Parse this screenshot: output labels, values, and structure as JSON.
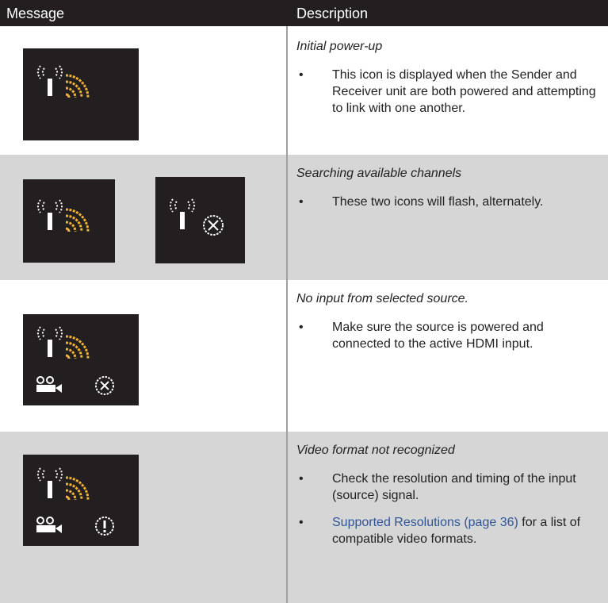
{
  "header": {
    "col1": "Message",
    "col2": "Description"
  },
  "rows": [
    {
      "title": "Initial power-up",
      "bullets": [
        {
          "text": "This icon is displayed when the Sender and Receiver unit are both powered and attempting to link with one another."
        }
      ]
    },
    {
      "title": "Searching available channels",
      "bullets": [
        {
          "text": "These two icons will flash, alternately."
        }
      ]
    },
    {
      "title": "No input from selected source.",
      "bullets": [
        {
          "text": "Make sure the source is powered and connected to the active HDMI input."
        }
      ]
    },
    {
      "title": "Video format not recognized",
      "bullets": [
        {
          "text": "Check the resolution and timing of the input (source) signal."
        },
        {
          "link": "Supported Resolutions (page 36)",
          "after": " for a list of compatible video formats."
        }
      ]
    }
  ],
  "bullet_char": "•",
  "colors": {
    "header_bg": "#231f20",
    "row_alt_bg": "#d6d6d6",
    "icon_orange": "#f2b134",
    "icon_white": "#ffffff",
    "link": "#2f5597"
  },
  "icons": [
    "antenna-icon",
    "signal-waves-icon",
    "circle-x-icon",
    "camera-icon",
    "circle-exclamation-icon"
  ]
}
